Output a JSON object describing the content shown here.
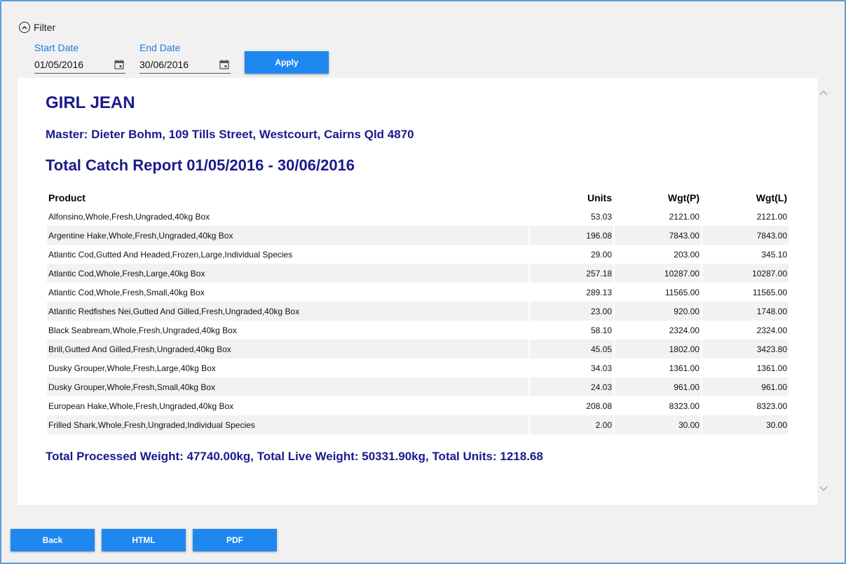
{
  "filter": {
    "label": "Filter",
    "start_label": "Start Date",
    "start_value": "01/05/2016",
    "end_label": "End Date",
    "end_value": "30/06/2016",
    "apply_label": "Apply"
  },
  "report": {
    "vessel": "GIRL JEAN",
    "master": "Master: Dieter Bohm, 109 Tills Street, Westcourt, Cairns Qld 4870",
    "heading": "Total Catch Report 01/05/2016 - 30/06/2016",
    "columns": {
      "product": "Product",
      "units": "Units",
      "wgt_p": "Wgt(P)",
      "wgt_l": "Wgt(L)"
    },
    "rows": [
      {
        "product": "Alfonsino,Whole,Fresh,Ungraded,40kg Box",
        "units": "53.03",
        "wgt_p": "2121.00",
        "wgt_l": "2121.00"
      },
      {
        "product": "Argentine Hake,Whole,Fresh,Ungraded,40kg Box",
        "units": "196.08",
        "wgt_p": "7843.00",
        "wgt_l": "7843.00"
      },
      {
        "product": "Atlantic Cod,Gutted And Headed,Frozen,Large,Individual Species",
        "units": "29.00",
        "wgt_p": "203.00",
        "wgt_l": "345.10"
      },
      {
        "product": "Atlantic Cod,Whole,Fresh,Large,40kg Box",
        "units": "257.18",
        "wgt_p": "10287.00",
        "wgt_l": "10287.00"
      },
      {
        "product": "Atlantic Cod,Whole,Fresh,Small,40kg Box",
        "units": "289.13",
        "wgt_p": "11565.00",
        "wgt_l": "11565.00"
      },
      {
        "product": "Atlantic Redfishes Nei,Gutted And Gilled,Fresh,Ungraded,40kg Box",
        "units": "23.00",
        "wgt_p": "920.00",
        "wgt_l": "1748.00"
      },
      {
        "product": "Black Seabream,Whole,Fresh,Ungraded,40kg Box",
        "units": "58.10",
        "wgt_p": "2324.00",
        "wgt_l": "2324.00"
      },
      {
        "product": "Brill,Gutted And Gilled,Fresh,Ungraded,40kg Box",
        "units": "45.05",
        "wgt_p": "1802.00",
        "wgt_l": "3423.80"
      },
      {
        "product": "Dusky Grouper,Whole,Fresh,Large,40kg Box",
        "units": "34.03",
        "wgt_p": "1361.00",
        "wgt_l": "1361.00"
      },
      {
        "product": "Dusky Grouper,Whole,Fresh,Small,40kg Box",
        "units": "24.03",
        "wgt_p": "961.00",
        "wgt_l": "961.00"
      },
      {
        "product": "European Hake,Whole,Fresh,Ungraded,40kg Box",
        "units": "208.08",
        "wgt_p": "8323.00",
        "wgt_l": "8323.00"
      },
      {
        "product": "Frilled Shark,Whole,Fresh,Ungraded,Individual Species",
        "units": "2.00",
        "wgt_p": "30.00",
        "wgt_l": "30.00"
      }
    ],
    "total": "Total Processed Weight: 47740.00kg, Total Live Weight: 50331.90kg, Total Units: 1218.68"
  },
  "footer": {
    "back_label": "Back",
    "html_label": "HTML",
    "pdf_label": "PDF"
  },
  "icons": {
    "filter": "chevron-up-circle-icon",
    "calendar": "calendar-icon",
    "scroll_up": "chevron-up-icon",
    "scroll_down": "chevron-down-icon"
  },
  "colors": {
    "accent": "#1e88f0",
    "label_blue": "#1e7be0",
    "report_text": "#1a1a8c",
    "border": "#5b9bd5"
  }
}
